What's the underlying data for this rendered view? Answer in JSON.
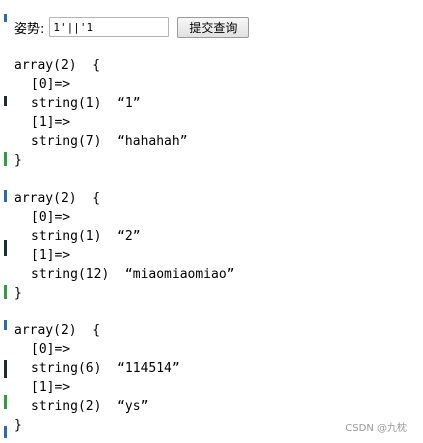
{
  "form": {
    "label": "姿势:",
    "input_value": "1'||'1",
    "submit_label": "提交查询"
  },
  "results": [
    {
      "header": "array(2)  {",
      "key0": "[0]=>",
      "val0": "string(1)  “1”",
      "key1": "[1]=>",
      "val1": "string(7)  “hahahah”",
      "close": "}"
    },
    {
      "header": "array(2)  {",
      "key0": "[0]=>",
      "val0": "string(1)  “2”",
      "key1": "[1]=>",
      "val1": "string(12)  “miaomiaomiao”",
      "close": "}"
    },
    {
      "header": "array(2)  {",
      "key0": "[0]=>",
      "val0": "string(6)  “114514”",
      "key1": "[1]=>",
      "val1": "string(2)  “ys”",
      "close": "}"
    }
  ],
  "watermark": "CSDN @九枕",
  "colors": {
    "edge_blue": "#2b6cb0",
    "edge_green": "#2f9e44",
    "edge_dark": "#1f2937"
  }
}
